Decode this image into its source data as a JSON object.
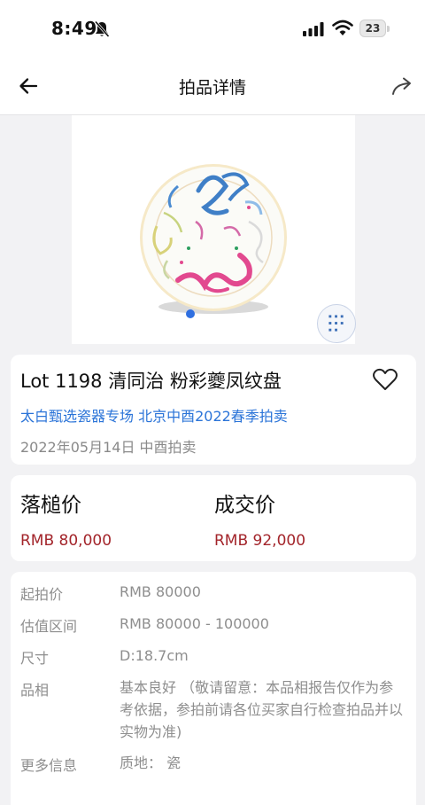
{
  "status_bar": {
    "time": "8:49",
    "battery": "23"
  },
  "nav": {
    "title": "拍品详情"
  },
  "lot": {
    "title": "Lot 1198 清同治 粉彩夔凤纹盘",
    "session": "太白甄选瓷器专场 北京中酉2022春季拍卖",
    "date": "2022年05月14日 中酉拍卖"
  },
  "prices": {
    "hammer_label": "落槌价",
    "hammer_value": "RMB 80,000",
    "deal_label": "成交价",
    "deal_value": "RMB 92,000"
  },
  "info": {
    "rows": [
      {
        "label": "起拍价",
        "value": "RMB 80000"
      },
      {
        "label": "估值区间",
        "value": "RMB 80000 - 100000"
      },
      {
        "label": "尺寸",
        "value": "D:18.7cm"
      },
      {
        "label": "品相",
        "value": "基本良好 （敬请留意：本品相报告仅作为参考依据，参拍前请各位买家自行检查拍品并以实物为准)"
      },
      {
        "label": "更多信息",
        "value": "质地： 瓷"
      }
    ]
  },
  "colors": {
    "accent_blue": "#2b74d8",
    "price_red": "#a3252b",
    "page_bg": "#f2f2f4"
  },
  "icons": [
    "bell-slash-icon",
    "signal-icon",
    "wifi-icon",
    "battery-icon",
    "back-arrow-icon",
    "share-icon",
    "heart-icon"
  ]
}
